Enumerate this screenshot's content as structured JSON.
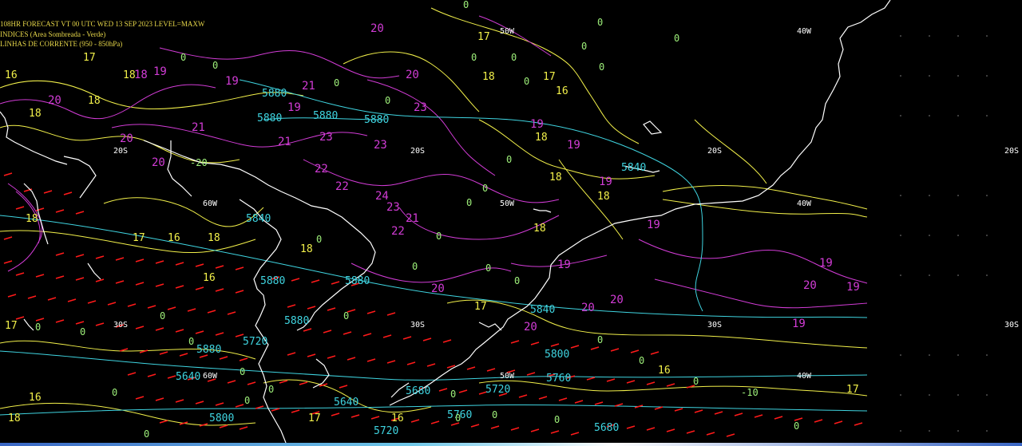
{
  "header": {
    "line1": "108HR FORECAST   VT 00 UTC WED 13 SEP 2023   LEVEL=MAXW",
    "line2": "INDICES (Area Sombreada - Verde)",
    "line3": "LINHAS DE CORRENTE (950 - 850hPa)"
  },
  "colors": {
    "background": "#000000",
    "coast": "#ffffff",
    "isoline_yellow": "#f2f04a",
    "isoline_magenta": "#d23cd6",
    "isoline_cyan": "#3fd4e0",
    "index_green": "#9ef07a",
    "wind_barbs": "#ff1a1a",
    "header_text": "#e8d84a"
  },
  "grid_labels": {
    "lon_40w_top": "40W",
    "lon_50w_top": "50W",
    "lat_20s_left": "20S",
    "lat_20s_mid": "20S",
    "lat_20s_right": "20S",
    "lat_20s_far": "20S",
    "lon_60w": "60W",
    "lon_50w_mid": "50W",
    "lon_40w_mid": "40W",
    "lat_30s_left": "30S",
    "lat_30s_mid": "30S",
    "lat_30s_right": "30S",
    "lat_30s_far": "30S",
    "lon_60w_low": "60W",
    "lon_50w_low": "50W",
    "lon_40w_low": "40W"
  },
  "cyan_labels": [
    "5880",
    "5880",
    "5880",
    "5880",
    "5840",
    "5840",
    "5880",
    "5880",
    "5880",
    "5840",
    "5760",
    "5800",
    "5720",
    "5640",
    "5720",
    "5680",
    "5640",
    "5800",
    "5760",
    "5720",
    "5680",
    "5880"
  ],
  "magenta_labels": [
    "20",
    "20",
    "19",
    "21",
    "19",
    "23",
    "21",
    "23",
    "22",
    "19",
    "23",
    "20",
    "20",
    "21",
    "20",
    "18",
    "19",
    "21",
    "24",
    "23",
    "22",
    "22",
    "19",
    "19",
    "19",
    "19",
    "20",
    "20",
    "20",
    "20",
    "19",
    "19",
    "20",
    "19"
  ],
  "yellow_labels": [
    "18",
    "18",
    "18",
    "17",
    "18",
    "16",
    "18",
    "16",
    "17",
    "17",
    "18",
    "18",
    "17",
    "17",
    "18",
    "16",
    "18",
    "18",
    "16",
    "18",
    "17",
    "16",
    "16",
    "17",
    "17",
    "16",
    "18"
  ],
  "green_labels": [
    "0",
    "0",
    "0",
    "0",
    "0",
    "0",
    "0",
    "0",
    "0",
    "0",
    "0",
    "0",
    "0",
    "0",
    "0",
    "0",
    "0",
    "0",
    "-10",
    "-20",
    "0",
    "0",
    "0",
    "0",
    "0",
    "0",
    "0",
    "0",
    "0",
    "0",
    "0",
    "0",
    "0",
    "0",
    "0",
    "0",
    "0",
    "0",
    "0",
    "0"
  ]
}
